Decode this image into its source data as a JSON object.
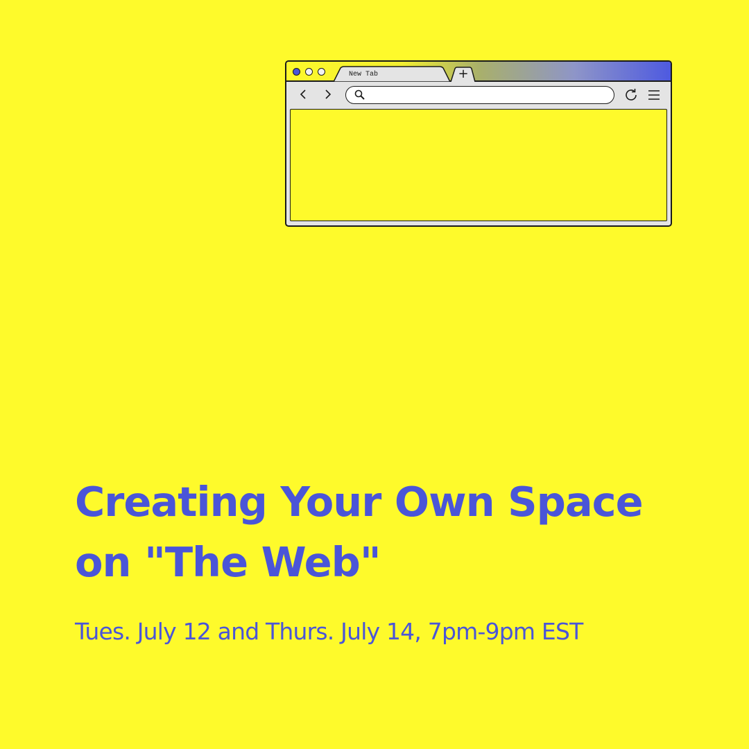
{
  "browser": {
    "tab_label": "New Tab",
    "new_tab_label": "+",
    "address_value": "",
    "icons": {
      "close": "window-close-dot-icon",
      "minimize": "window-minimize-dot-icon",
      "maximize": "window-maximize-dot-icon",
      "back": "chevron-left-icon",
      "forward": "chevron-right-icon",
      "search": "search-icon",
      "reload": "reload-icon",
      "menu": "hamburger-menu-icon"
    }
  },
  "event": {
    "title_line1": "Creating Your Own Space",
    "title_line2": "on \"The Web\"",
    "schedule": "Tues. July 12 and Thurs. July 14, 7pm-9pm EST"
  },
  "colors": {
    "background": "#fefa2b",
    "accent": "#4a55d8",
    "outline": "#1a1a1a",
    "chrome": "#e4e4e4"
  }
}
